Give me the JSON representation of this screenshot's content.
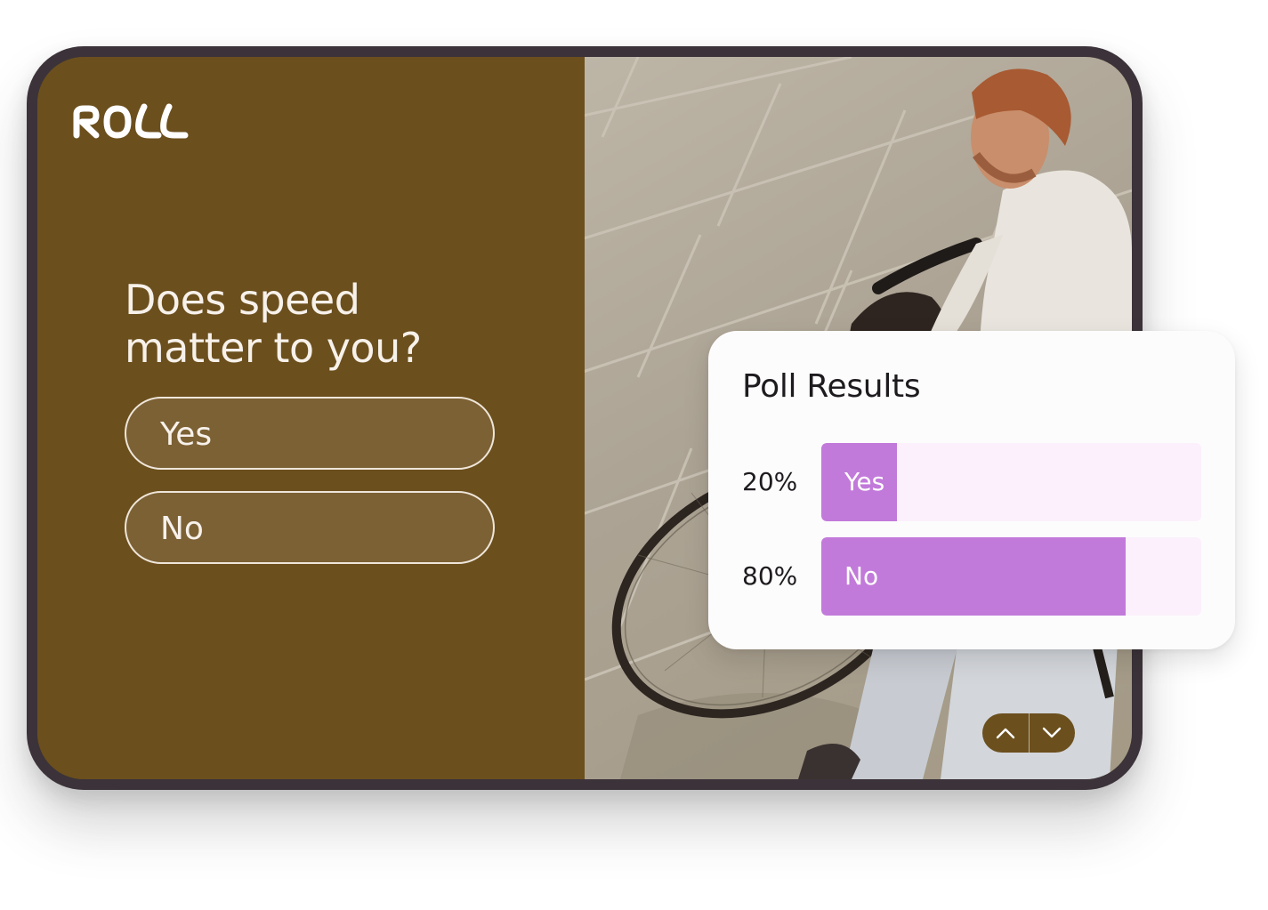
{
  "brand": {
    "logo_text": "ROLL"
  },
  "question": {
    "line1": "Does speed",
    "line2": "matter to you?"
  },
  "options": [
    {
      "label": "Yes"
    },
    {
      "label": "No"
    }
  ],
  "poll": {
    "title": "Poll Results",
    "results": [
      {
        "label": "Yes",
        "percent_text": "20%",
        "fraction": 0.2
      },
      {
        "label": "No",
        "percent_text": "80%",
        "fraction": 0.8
      }
    ]
  },
  "navigation": {
    "up_icon": "chevron-up-icon",
    "down_icon": "chevron-down-icon"
  },
  "colors": {
    "panel": "#6b4f1d",
    "option_fill": "#7c6135",
    "bar_fill": "#c27ada",
    "bar_track": "#fbf0fc",
    "device_frame": "#3b3339"
  }
}
